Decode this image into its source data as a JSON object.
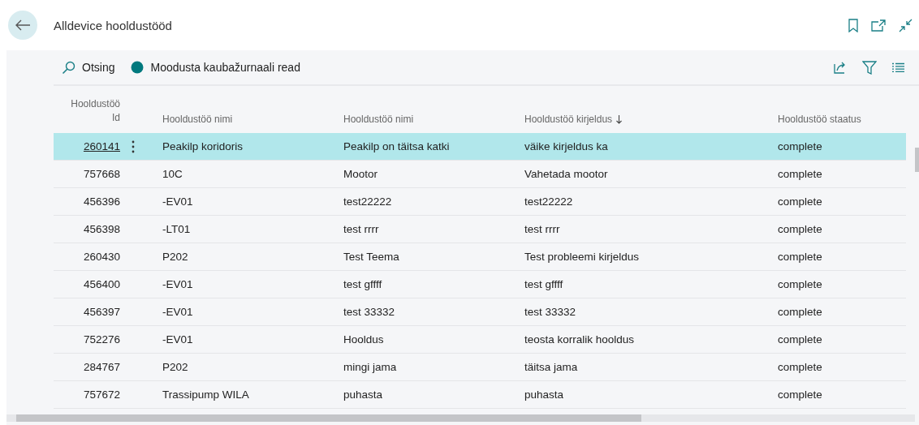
{
  "page": {
    "title": "Alldevice hooldustööd"
  },
  "actions": [
    {
      "label": "Otsing",
      "kind": "search"
    },
    {
      "label": "Moodusta kaubažurnaali read",
      "kind": "action"
    }
  ],
  "columns": [
    {
      "label": "Hooldustöö Id",
      "sorted": false
    },
    {
      "label": "Hooldustöö nimi",
      "sorted": false
    },
    {
      "label": "Hooldustöö nimi",
      "sorted": false
    },
    {
      "label": "Hooldustöö kirjeldus",
      "sorted": true
    },
    {
      "label": "Hooldustöö staatus",
      "sorted": false
    }
  ],
  "rows": [
    {
      "selected": true,
      "cells": [
        "260141",
        "Peakilp koridoris",
        "Peakilp on täitsa katki",
        "väike kirjeldus ka",
        "complete"
      ]
    },
    {
      "selected": false,
      "cells": [
        "757668",
        "10C",
        "Mootor",
        "Vahetada mootor",
        "complete"
      ]
    },
    {
      "selected": false,
      "cells": [
        "456396",
        "-EV01",
        "test22222",
        "test22222",
        "complete"
      ]
    },
    {
      "selected": false,
      "cells": [
        "456398",
        "-LT01",
        "test rrrr",
        "test rrrr",
        "complete"
      ]
    },
    {
      "selected": false,
      "cells": [
        "260430",
        "P202",
        "Test Teema",
        "Test probleemi kirjeldus",
        "complete"
      ]
    },
    {
      "selected": false,
      "cells": [
        "456400",
        "-EV01",
        "test gffff",
        "test gffff",
        "complete"
      ]
    },
    {
      "selected": false,
      "cells": [
        "456397",
        "-EV01",
        "test 33332",
        "test 33332",
        "complete"
      ]
    },
    {
      "selected": false,
      "cells": [
        "752276",
        "-EV01",
        "Hooldus",
        "teosta korralik hooldus",
        "complete"
      ]
    },
    {
      "selected": false,
      "cells": [
        "284767",
        "P202",
        "mingi jama",
        "täitsa jama",
        "complete"
      ]
    },
    {
      "selected": false,
      "cells": [
        "757672",
        "Trassipump WILA",
        "puhasta",
        "puhasta",
        "complete"
      ]
    }
  ]
}
